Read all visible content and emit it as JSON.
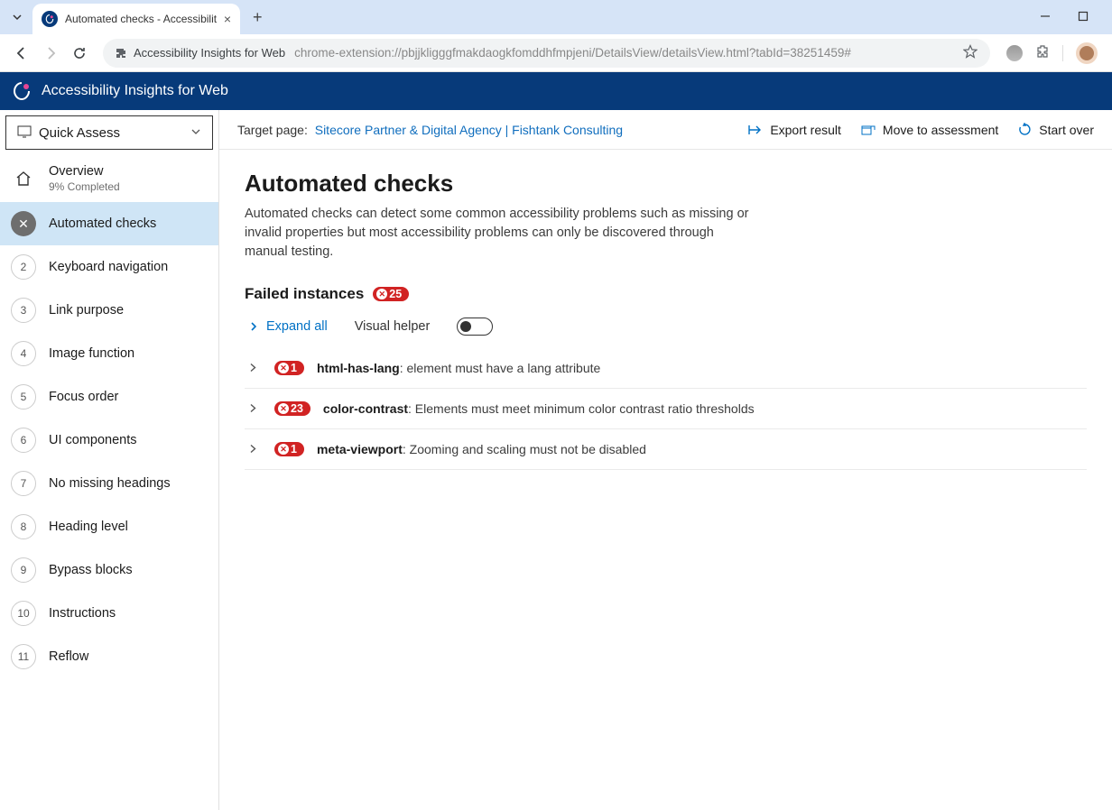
{
  "browser": {
    "tab_title": "Automated checks - Accessibilit",
    "omnibox_label": "Accessibility Insights for Web",
    "url": "chrome-extension://pbjjkligggfmakdaogkfomddhfmpjeni/DetailsView/detailsView.html?tabId=38251459#"
  },
  "app": {
    "title": "Accessibility Insights for Web"
  },
  "sidebar": {
    "selector_label": "Quick Assess",
    "overview": {
      "label": "Overview",
      "sub": "9% Completed"
    },
    "active": {
      "label": "Automated checks"
    },
    "items": [
      {
        "num": "2",
        "label": "Keyboard navigation"
      },
      {
        "num": "3",
        "label": "Link purpose"
      },
      {
        "num": "4",
        "label": "Image function"
      },
      {
        "num": "5",
        "label": "Focus order"
      },
      {
        "num": "6",
        "label": "UI components"
      },
      {
        "num": "7",
        "label": "No missing headings"
      },
      {
        "num": "8",
        "label": "Heading level"
      },
      {
        "num": "9",
        "label": "Bypass blocks"
      },
      {
        "num": "10",
        "label": "Instructions"
      },
      {
        "num": "11",
        "label": "Reflow"
      }
    ]
  },
  "actions": {
    "target_label": "Target page:",
    "target_link": "Sitecore Partner & Digital Agency | Fishtank Consulting",
    "export": "Export result",
    "move": "Move to assessment",
    "start_over": "Start over"
  },
  "main": {
    "heading": "Automated checks",
    "description": "Automated checks can detect some common accessibility problems such as missing or invalid properties but most accessibility problems can only be discovered through manual testing.",
    "failed_heading": "Failed instances",
    "failed_count": "25",
    "expand_all": "Expand all",
    "visual_helper": "Visual helper",
    "rules": [
      {
        "count": "1",
        "name": "html-has-lang",
        "sep": ": ",
        "desc": "<html> element must have a lang attribute"
      },
      {
        "count": "23",
        "name": "color-contrast",
        "sep": ": ",
        "desc": "Elements must meet minimum color contrast ratio thresholds"
      },
      {
        "count": "1",
        "name": "meta-viewport",
        "sep": ": ",
        "desc": "Zooming and scaling must not be disabled"
      }
    ]
  }
}
